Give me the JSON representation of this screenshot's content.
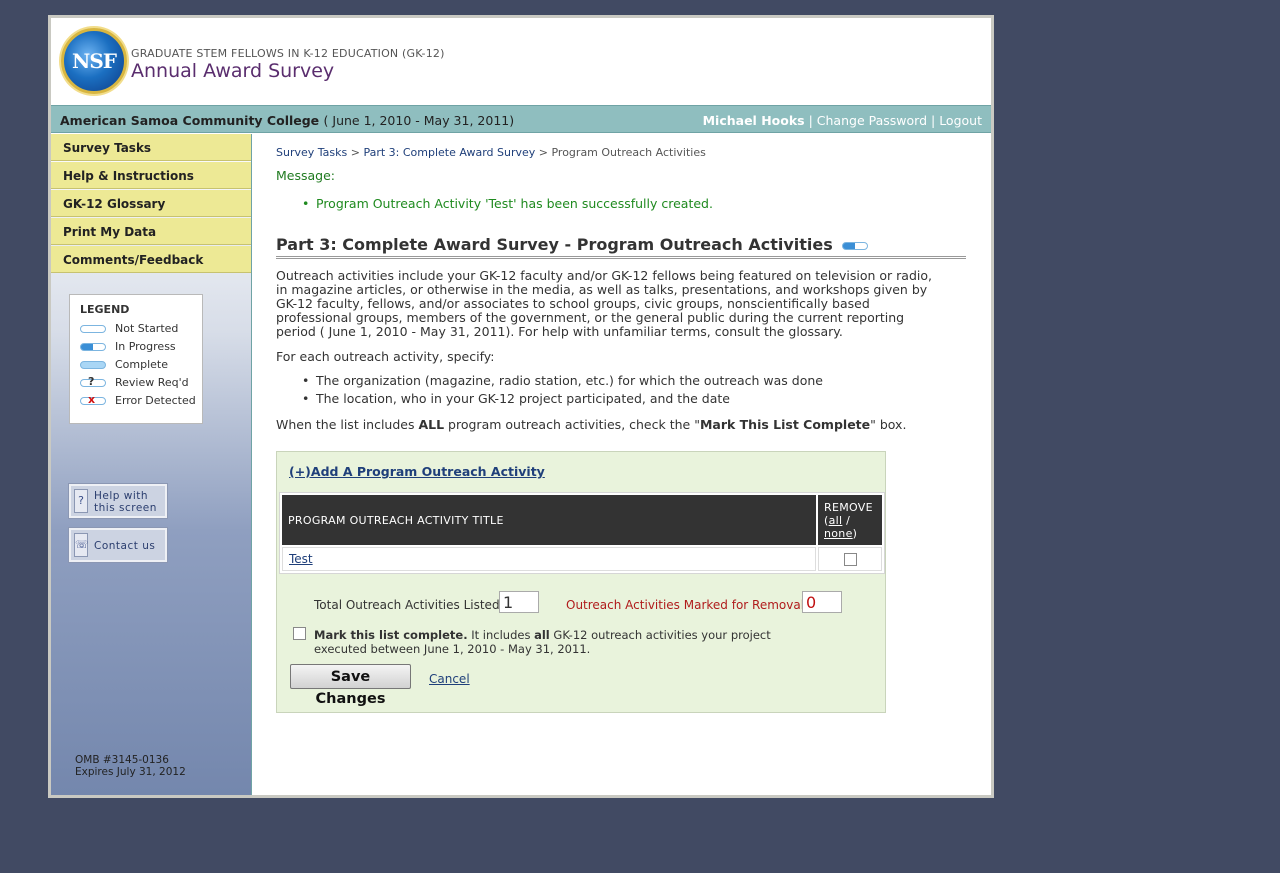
{
  "header": {
    "logo_text": "NSF",
    "program_title": "GRADUATE STEM FELLOWS IN K-12 EDUCATION (GK-12)",
    "survey_title": "Annual Award Survey"
  },
  "infobar": {
    "organization": "American Samoa Community College",
    "period": "( June 1, 2010 - May 31, 2011)",
    "user": "Michael Hooks",
    "separator": "|",
    "change_password": "Change Password",
    "logout": "Logout"
  },
  "sidebar": {
    "nav": [
      {
        "label": "Survey Tasks"
      },
      {
        "label": "Help & Instructions"
      },
      {
        "label": "GK-12 Glossary"
      },
      {
        "label": "Print My Data"
      },
      {
        "label": "Comments/Feedback"
      }
    ],
    "legend": {
      "title": "LEGEND",
      "items": [
        {
          "label": "Not Started",
          "mark": ""
        },
        {
          "label": "In Progress",
          "mark": ""
        },
        {
          "label": "Complete",
          "mark": ""
        },
        {
          "label": "Review Req'd",
          "mark": "?"
        },
        {
          "label": "Error Detected",
          "mark": "x"
        }
      ]
    },
    "help_button": {
      "icon_glyph": "?",
      "line1": "Help with",
      "line2": "this screen"
    },
    "contact_button": {
      "icon_glyph": "☏",
      "label": "Contact us"
    },
    "omb_number": "OMB #3145-0136",
    "omb_expires": "Expires July 31, 2012"
  },
  "breadcrumb": {
    "item1": "Survey Tasks",
    "sep": ">",
    "item2": "Part 3: Complete Award Survey",
    "current": "Program Outreach Activities"
  },
  "message": {
    "label": "Message:",
    "text": "Program Outreach Activity 'Test' has been successfully created."
  },
  "section": {
    "title": "Part 3: Complete Award Survey - Program Outreach Activities",
    "intro": "Outreach activities include your GK-12 faculty and/or GK-12 fellows being featured on television or radio, in magazine articles, or otherwise in the media, as well as talks, presentations, and workshops given by GK-12 faculty, fellows, and/or associates to school groups, civic groups, nonscientifically based professional groups, members of the government, or the general public during the current reporting period ( June 1, 2010 - May 31, 2011). For help with unfamiliar terms, consult the glossary.",
    "specify": "For each outreach activity, specify:",
    "bullets": [
      "The organization (magazine, radio station, etc.) for which the outreach was done",
      "The location, who in your GK-12 project participated, and the date"
    ],
    "instruction_pre": "When the list includes ",
    "instruction_all": "ALL",
    "instruction_mid": " program outreach activities, check the \"",
    "instruction_mark": "Mark This List Complete",
    "instruction_post": "\" box."
  },
  "list": {
    "add_link": "(+)Add A Program Outreach Activity",
    "col_title": "PROGRAM OUTREACH ACTIVITY TITLE",
    "col_remove": "REMOVE",
    "col_remove_all": "all",
    "col_remove_slash": " / ",
    "col_remove_none": "none",
    "rows": [
      {
        "title": "Test",
        "remove_checked": false
      }
    ],
    "totals_label": "Total Outreach Activities Listed:",
    "totals_value": "1",
    "removal_label": "Outreach Activities Marked for Removal:",
    "removal_value": "0",
    "complete_bold": "Mark this list complete.",
    "complete_text1": " It includes ",
    "complete_all": "all",
    "complete_text2": " GK-12 outreach activities your project executed between June 1, 2010 - May 31, 2011.",
    "complete_checked": false,
    "save_label": "Save Changes",
    "cancel_label": "Cancel"
  },
  "colors": {
    "page_bg": "#414a63",
    "infobar_bg": "#8fbebf",
    "nav_bg": "#ede995",
    "message_green": "#1f8a1f",
    "link_blue": "#1f3f7a",
    "panel_bg": "#e9f3dc",
    "removal_red": "#b01c1c"
  }
}
